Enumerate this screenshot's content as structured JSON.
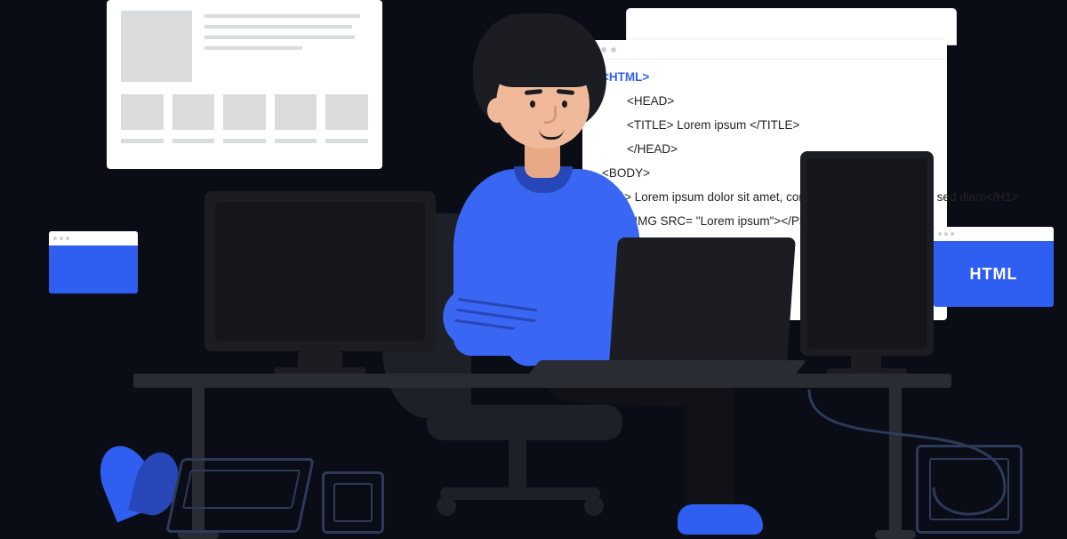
{
  "code_window": {
    "lines": {
      "l1": "<HTML>",
      "l2": "<HEAD>",
      "l3": "<TITLE> Lorem ipsum </TITLE>",
      "l4": "</HEAD>",
      "l5": "<BODY>",
      "l6": "<H1> Lorem ipsum dolor sit amet, consectetuer adipiscing elit, sed diam</H1>",
      "l7": "<P> <IMG SRC= \"Lorem ipsum\"></P>"
    }
  },
  "badge": {
    "label": "HTML"
  }
}
